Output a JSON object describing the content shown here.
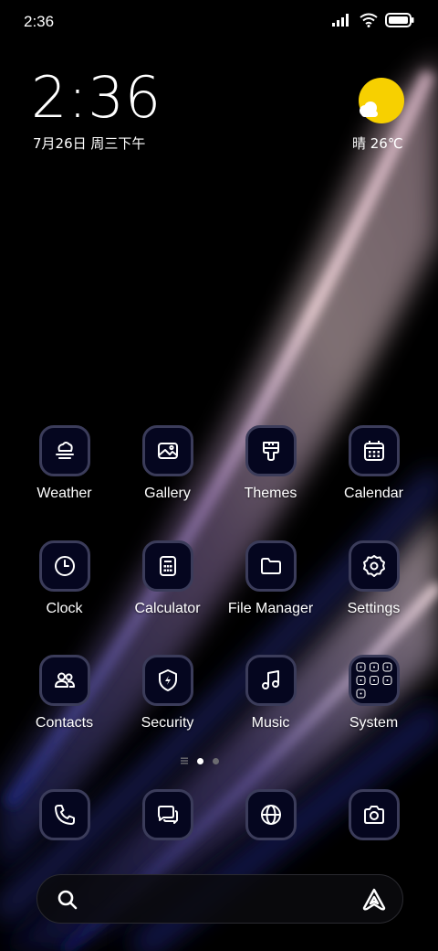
{
  "status_bar": {
    "time": "2:36",
    "icons": [
      "signal-icon",
      "wifi-icon",
      "battery-icon"
    ]
  },
  "clock_widget": {
    "time": "2:36",
    "date": "7月26日 周三下午"
  },
  "weather_widget": {
    "text": "晴 26℃",
    "icon": "sunny-cloud-icon",
    "sun_color": "#f7d000"
  },
  "apps": [
    {
      "label": "Weather",
      "icon": "weather-icon"
    },
    {
      "label": "Gallery",
      "icon": "gallery-icon"
    },
    {
      "label": "Themes",
      "icon": "themes-icon"
    },
    {
      "label": "Calendar",
      "icon": "calendar-icon"
    },
    {
      "label": "Clock",
      "icon": "clock-icon"
    },
    {
      "label": "Calculator",
      "icon": "calculator-icon"
    },
    {
      "label": "File Manager",
      "icon": "folder-icon"
    },
    {
      "label": "Settings",
      "icon": "gear-icon"
    },
    {
      "label": "Contacts",
      "icon": "contacts-icon"
    },
    {
      "label": "Security",
      "icon": "shield-icon"
    },
    {
      "label": "Music",
      "icon": "music-icon"
    },
    {
      "label": "System",
      "icon": "folder-grid-icon"
    }
  ],
  "page_indicator": {
    "pages": 2,
    "current": 1
  },
  "dock": [
    {
      "icon": "phone-icon"
    },
    {
      "icon": "messages-icon"
    },
    {
      "icon": "browser-icon"
    },
    {
      "icon": "camera-icon"
    }
  ],
  "search_bar": {
    "left_icon": "search-icon",
    "right_icon": "assistant-icon"
  },
  "colors": {
    "tile_bg": "#05061f",
    "tile_border": "#3b3c5a",
    "icon_stroke": "#ffffff"
  }
}
